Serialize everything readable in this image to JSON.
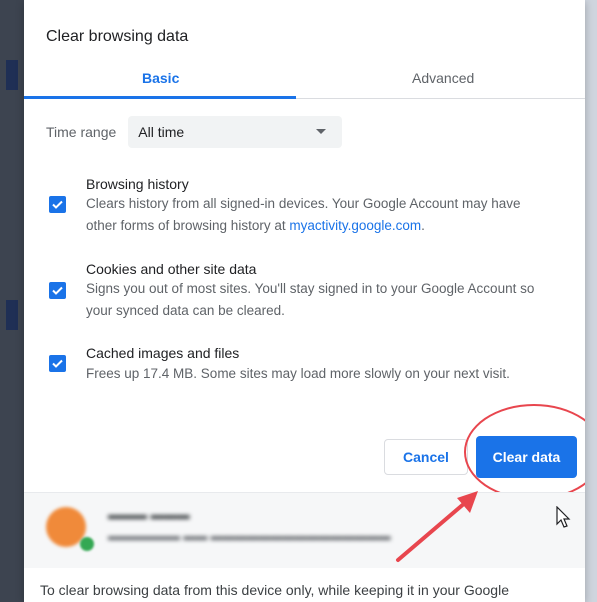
{
  "dialog": {
    "title": "Clear browsing data"
  },
  "tabs": [
    {
      "label": "Basic",
      "selected": true
    },
    {
      "label": "Advanced",
      "selected": false
    }
  ],
  "time_range": {
    "label": "Time range",
    "selected": "All time"
  },
  "options": [
    {
      "title": "Browsing history",
      "desc_lines": [
        "Clears history from all signed-in devices. Your Google Account may have",
        "other forms of browsing history at "
      ],
      "link": "myactivity.google.com",
      "link_suffix": ".",
      "checked": true
    },
    {
      "title": "Cookies and other site data",
      "desc_lines": [
        "Signs you out of most sites. You'll stay signed in to your Google Account so",
        "your synced data can be cleared."
      ],
      "checked": true
    },
    {
      "title": "Cached images and files",
      "desc_lines": [
        "Frees up 17.4 MB. Some sites may load more slowly on your next visit."
      ],
      "checked": true
    }
  ],
  "buttons": {
    "cancel": "Cancel",
    "clear": "Clear data"
  },
  "footer_note": "To clear browsing data from this device only, while keeping it in your Google",
  "colors": {
    "accent": "#1a73e8",
    "annotation": "#e8464e"
  },
  "icons": {
    "checkbox": "check-icon",
    "dropdown": "caret-down-icon",
    "cursor": "mouse-pointer-icon",
    "annotation_arrow": "red-arrow-icon"
  }
}
